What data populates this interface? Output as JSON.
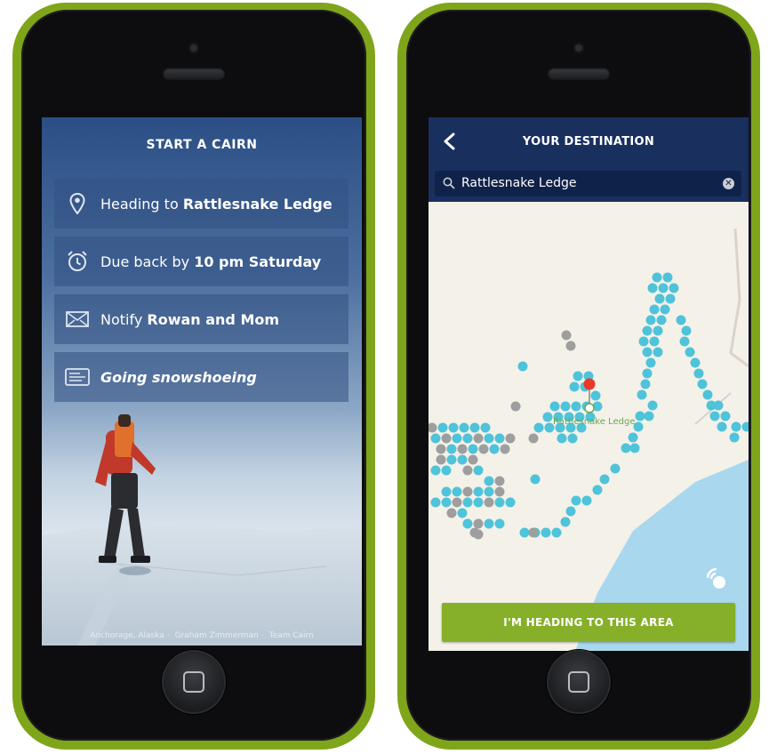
{
  "left_screen": {
    "title": "START A CAIRN",
    "rows": [
      {
        "icon": "location-pin-icon",
        "prefix": "Heading to ",
        "value": "Rattlesnake Ledge"
      },
      {
        "icon": "alarm-clock-icon",
        "prefix": "Due back by ",
        "value": "10 pm Saturday"
      },
      {
        "icon": "envelope-icon",
        "prefix": "Notify ",
        "value": "Rowan and Mom"
      },
      {
        "icon": "note-icon",
        "prefix": "",
        "value": "Going snowshoeing"
      }
    ],
    "credits": [
      "Anchorage, Alaska",
      "Graham Zimmerman",
      "Team Cairn"
    ]
  },
  "right_screen": {
    "title": "YOUR DESTINATION",
    "back_icon": "chevron-left-icon",
    "search": {
      "value": "Rattlesnake Ledge",
      "icon": "search-icon",
      "clear_icon": "clear-icon"
    },
    "map": {
      "place_label": "Rattlesnake Ledge",
      "marker_color": "#e8392b",
      "dot_color": "#4fc3d9",
      "visited_color": "#9e9e9e",
      "water_color": "#a9d8ee"
    },
    "cta_label": "I'M HEADING TO THIS AREA",
    "locate_icon": "locate-signal-icon"
  },
  "colors": {
    "frame": "#7fa51a",
    "header": "#19305f",
    "cta": "#86b02a"
  }
}
